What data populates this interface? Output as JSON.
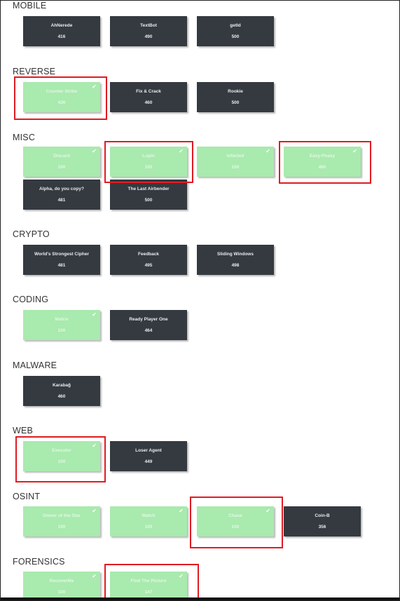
{
  "categories": [
    {
      "name": "MOBILE",
      "challenges": [
        {
          "name": "AhNerede",
          "points": "416",
          "solved": false
        },
        {
          "name": "TextBot",
          "points": "490",
          "solved": false
        },
        {
          "name": "getId",
          "points": "500",
          "solved": false
        }
      ]
    },
    {
      "name": "REVERSE",
      "challenges": [
        {
          "name": "Counter Strike",
          "points": "436",
          "solved": true
        },
        {
          "name": "Fix & Crack",
          "points": "460",
          "solved": false
        },
        {
          "name": "Rookie",
          "points": "500",
          "solved": false
        }
      ]
    },
    {
      "name": "MISC",
      "challenges": [
        {
          "name": "Discard",
          "points": "100",
          "solved": true
        },
        {
          "name": "Lupin",
          "points": "100",
          "solved": true
        },
        {
          "name": "Infected",
          "points": "100",
          "solved": true
        },
        {
          "name": "Easy-Peasy",
          "points": "460",
          "solved": true
        },
        {
          "name": "Alpha, do you copy?",
          "points": "481",
          "solved": false
        },
        {
          "name": "The Last Airbender",
          "points": "500",
          "solved": false
        }
      ]
    },
    {
      "name": "CRYPTO",
      "challenges": [
        {
          "name": "World's Strongest Cipher",
          "points": "481",
          "solved": false
        },
        {
          "name": "Feedback",
          "points": "495",
          "solved": false
        },
        {
          "name": "Sliding Windows",
          "points": "498",
          "solved": false
        }
      ]
    },
    {
      "name": "CODING",
      "challenges": [
        {
          "name": "Matrix",
          "points": "100",
          "solved": true
        },
        {
          "name": "Ready Player One",
          "points": "464",
          "solved": false
        }
      ]
    },
    {
      "name": "MALWARE",
      "challenges": [
        {
          "name": "Karabağ",
          "points": "460",
          "solved": false
        }
      ]
    },
    {
      "name": "WEB",
      "challenges": [
        {
          "name": "Executer",
          "points": "100",
          "solved": true
        },
        {
          "name": "Loser Agent",
          "points": "449",
          "solved": false
        }
      ]
    },
    {
      "name": "OSINT",
      "challenges": [
        {
          "name": "Owner of the Star",
          "points": "100",
          "solved": true
        },
        {
          "name": "Watch",
          "points": "100",
          "solved": true
        },
        {
          "name": "Chase",
          "points": "100",
          "solved": true
        },
        {
          "name": "Coin-B",
          "points": "356",
          "solved": false
        }
      ]
    },
    {
      "name": "FORENSICS",
      "challenges": [
        {
          "name": "RecoverMe",
          "points": "100",
          "solved": true
        },
        {
          "name": "Find The Picture",
          "points": "147",
          "solved": true
        }
      ]
    }
  ],
  "solved_check_icon": "check-icon",
  "colors": {
    "unsolved": "#343a40",
    "solved": "#a9eaae",
    "highlight": "#e01b22"
  }
}
